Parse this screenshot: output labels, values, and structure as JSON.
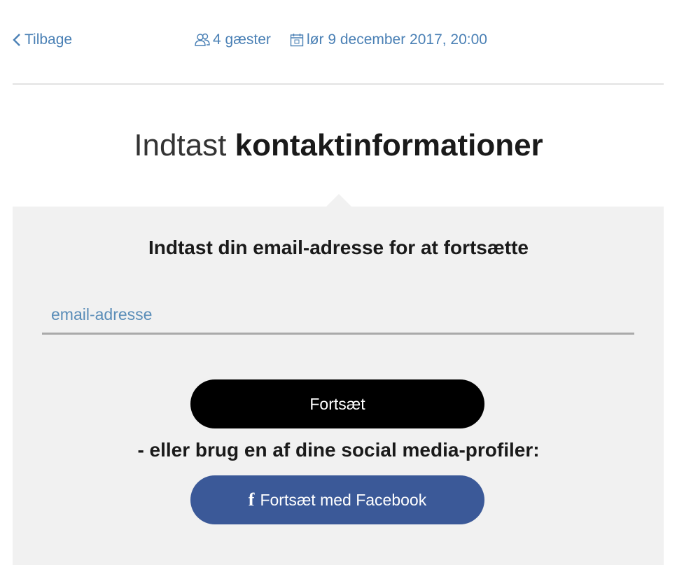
{
  "header": {
    "back_label": "Tilbage",
    "guests_label": "4 gæster",
    "date_label": "lør 9 december 2017, 20:00"
  },
  "title": {
    "light": "Indtast",
    "bold": "kontaktinformationer"
  },
  "form": {
    "prompt": "Indtast din email-adresse for at fortsætte",
    "email_placeholder": "email-adresse",
    "email_value": "",
    "continue_label": "Fortsæt",
    "social_label": "- eller brug en af dine social media-profiler:",
    "facebook_icon": "f",
    "facebook_label": "Fortsæt med Facebook"
  },
  "icons": {
    "back": "chevron-left-icon",
    "guests": "people-icon",
    "date": "calendar-icon",
    "facebook": "facebook-icon"
  },
  "colors": {
    "accent": "#4a80b5",
    "panel_bg": "#f1f1f1",
    "continue_bg": "#000000",
    "facebook_bg": "#3b5998"
  }
}
